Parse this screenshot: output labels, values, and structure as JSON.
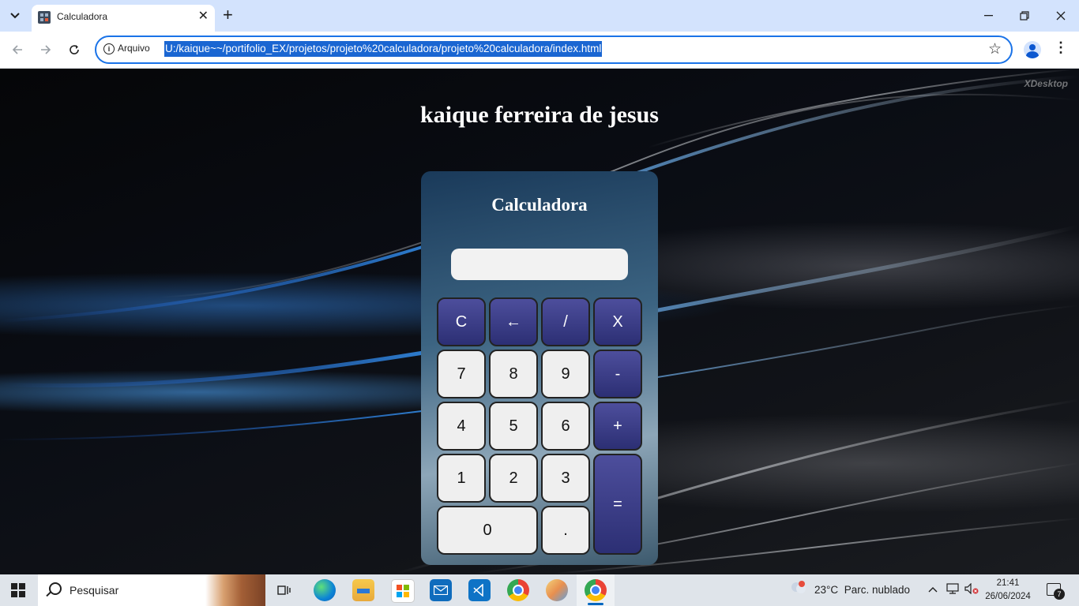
{
  "browser": {
    "tab": {
      "title": "Calculadora"
    },
    "address": {
      "security_label": "Arquivo",
      "url": "U:/kaique~~/portifolio_EX/projetos/projeto%20calculadora/projeto%20calculadora/index.html"
    }
  },
  "page": {
    "watermark": "XDesktop",
    "heading": "kaique ferreira de jesus",
    "calculator": {
      "title": "Calculadora",
      "display_value": "",
      "buttons": {
        "clear": "C",
        "backspace": "←",
        "divide": "/",
        "multiply": "X",
        "seven": "7",
        "eight": "8",
        "nine": "9",
        "minus": "-",
        "four": "4",
        "five": "5",
        "six": "6",
        "plus": "+",
        "one": "1",
        "two": "2",
        "three": "3",
        "equals": "=",
        "zero": "0",
        "decimal": "."
      }
    }
  },
  "taskbar": {
    "search_placeholder": "Pesquisar",
    "weather": {
      "temp": "23°C",
      "condition": "Parc. nublado"
    },
    "clock": {
      "time": "21:41",
      "date": "26/06/2024"
    },
    "notification_count": "7",
    "apps": [
      "task-view",
      "edge",
      "file-explorer",
      "microsoft-store",
      "mail",
      "vs-code",
      "chrome-profile",
      "paint",
      "chrome"
    ]
  },
  "colors": {
    "accent": "#1a73e8",
    "operator_button": "#3a3c86",
    "number_button": "#efefef",
    "tabbar": "#d3e3fd"
  }
}
